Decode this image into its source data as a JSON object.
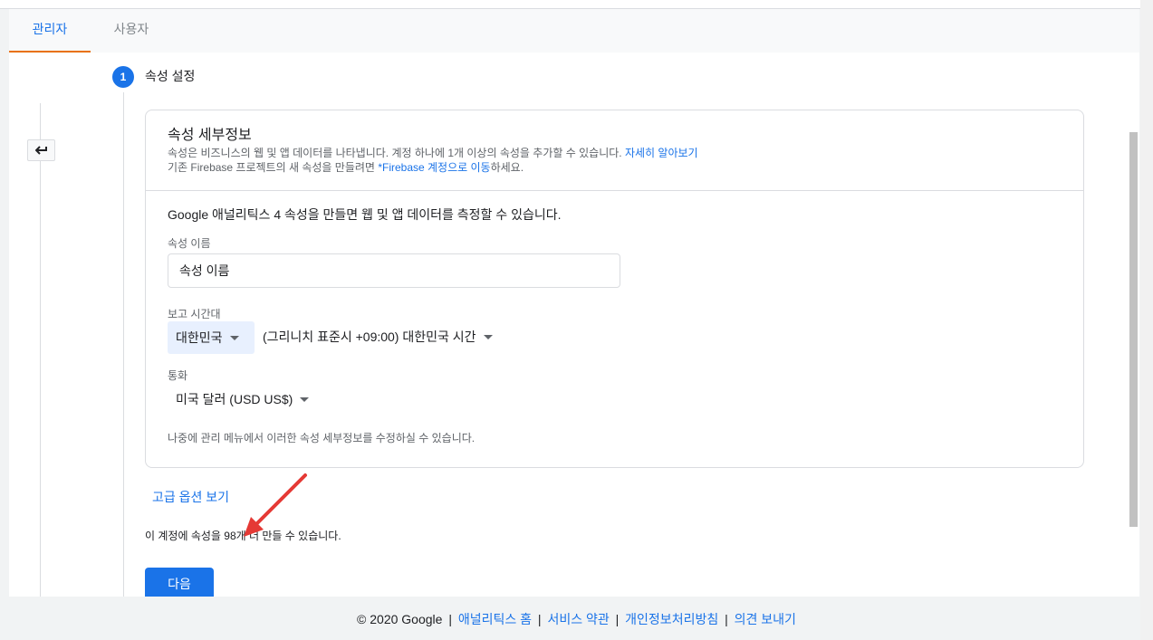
{
  "tabs": [
    {
      "label": "관리자",
      "active": true
    },
    {
      "label": "사용자",
      "active": false
    }
  ],
  "back_button": {
    "icon": "back-arrow-icon"
  },
  "step": {
    "number": "1",
    "title": "속성 설정"
  },
  "property_details": {
    "title": "속성 세부정보",
    "desc_line1_prefix": "속성은 비즈니스의 웹 및 앱 데이터를 나타냅니다. 계정 하나에 1개 이상의 속성을 추가할 수 있습니다.",
    "desc_line1_link": "자세히 알아보기",
    "desc_line2_prefix": "기존 Firebase 프로젝트의 새 속성을 만들려면",
    "desc_line2_link": "*Firebase 계정으로 이동",
    "desc_line2_suffix": "하세요.",
    "intro": "Google 애널리틱스 4 속성을 만들면 웹 및 앱 데이터를 측정할 수 있습니다.",
    "name_label": "속성 이름",
    "name_placeholder": "속성 이름",
    "timezone_label": "보고 시간대",
    "country_value": "대한민국",
    "timezone_value": "(그리니치 표준시 +09:00) 대한민국 시간",
    "currency_label": "통화",
    "currency_value": "미국 달러 (USD US$)",
    "note": "나중에 관리 메뉴에서 이러한 속성 세부정보를 수정하실 수 있습니다."
  },
  "advanced_options_link": "고급 옵션 보기",
  "remaining_text": "이 계정에 속성을 98개 더 만들 수 있습니다.",
  "next_button": "다음",
  "footer": {
    "copyright": "© 2020 Google",
    "links": [
      "애널리틱스 홈",
      "서비스 약관",
      "개인정보처리방침",
      "의견 보내기"
    ]
  },
  "colors": {
    "accent": "#1a73e8",
    "tab_underline": "#e8710a",
    "annotation_arrow": "#e53935"
  }
}
